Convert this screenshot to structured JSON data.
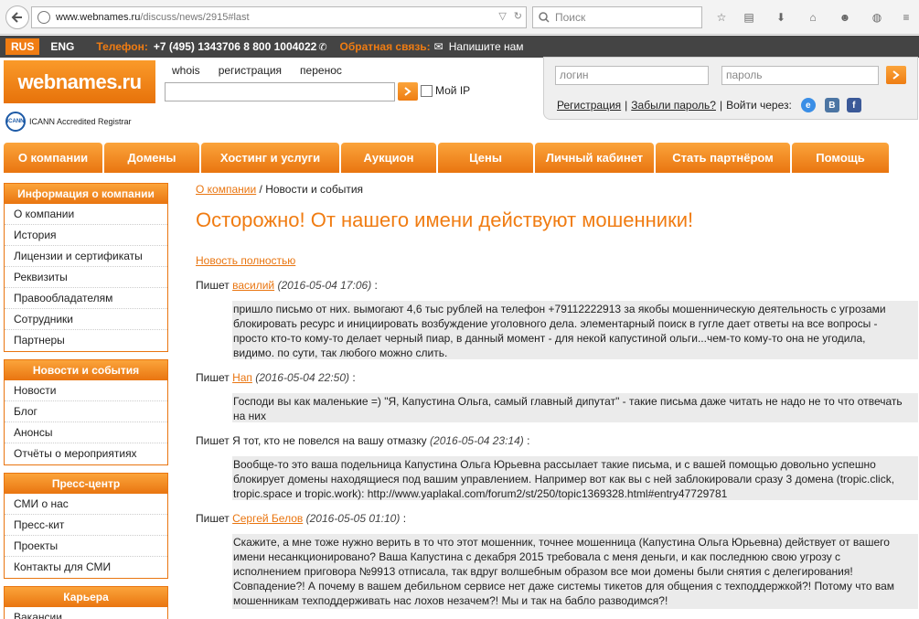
{
  "browser": {
    "url_host": "www.webnames.ru",
    "url_path": "/discuss/news/2915#last",
    "search_placeholder": "Поиск"
  },
  "topline": {
    "lang_ru": "RUS",
    "lang_en": "ENG",
    "phone_label": "Телефон:",
    "phone_numbers": "+7 (495) 1343706  8 800 1004022",
    "feedback_label": "Обратная связь:",
    "feedback_link": "Напишите нам"
  },
  "header": {
    "logo_text": "webnames.ru",
    "icann_text": "ICANN Accredited Registrar",
    "nav": [
      "whois",
      "регистрация",
      "перенос"
    ],
    "my_ip_label": "Мой IP"
  },
  "login": {
    "login_placeholder": "логин",
    "password_placeholder": "пароль",
    "register_link": "Регистрация",
    "forgot_link": "Забыли пароль?",
    "login_via": "Войти через:",
    "social": [
      "e",
      "В",
      "f"
    ]
  },
  "main_nav": [
    "О компании",
    "Домены",
    "Хостинг и услуги",
    "Аукцион",
    "Цены",
    "Личный кабинет",
    "Стать партнёром",
    "Помощь"
  ],
  "sidebar": [
    {
      "header": "Информация о компании",
      "items": [
        "О компании",
        "История",
        "Лицензии и сертификаты",
        "Реквизиты",
        "Правообладателям",
        "Сотрудники",
        "Партнеры"
      ]
    },
    {
      "header": "Новости и события",
      "items": [
        "Новости",
        "Блог",
        "Анонсы",
        "Отчёты о мероприятиях"
      ]
    },
    {
      "header": "Пресс-центр",
      "items": [
        "СМИ о нас",
        "Пресс-кит",
        "Проекты",
        "Контакты для СМИ"
      ]
    },
    {
      "header": "Карьера",
      "items": [
        "Вакансии"
      ]
    }
  ],
  "content": {
    "breadcrumb_link": "О компании",
    "breadcrumb_current": "Новости и события",
    "title": "Осторожно! От нашего имени действуют мошенники!",
    "full_news_link": "Новость полностью",
    "posts": [
      {
        "prefix": "Пишет",
        "author": "василий",
        "author_link": true,
        "date": "(2016-05-04 17:06)",
        "text": "пришло письмо от них. вымогают 4,6 тыс рублей на телефон +79112222913 за якобы мошенническую деятельность с угрозами блокировать ресурс и инициировать возбуждение уголовного дела. элементарный поиск в гугле дает ответы на все вопросы - просто кто-то кому-то делает черный пиар, в данный момент - для некой капустиной ольги...чем-то кому-то она не угодила, видимо. по сути, так любого можно слить."
      },
      {
        "prefix": "Пишет",
        "author": "Нап",
        "author_link": true,
        "date": "(2016-05-04 22:50)",
        "text": "Господи вы как маленькие =) \"Я, Капустина Ольга, самый главный дипутат\" - такие письма даже читать не надо не то что отвечать на них"
      },
      {
        "prefix": "Пишет",
        "author": "Я тот, кто не повелся на вашу отмазку",
        "author_link": false,
        "date": "(2016-05-04 23:14)",
        "text": "Вообще-то это ваша подельница Капустина Ольга Юрьевна рассылает такие письма, и с вашей помощью довольно успешно блокирует домены находящиеся под вашим управлением. Например вот как вы с ней заблокировали сразу 3 домена (tropic.click, tropic.space и tropic.work): http://www.yaplakal.com/forum2/st/250/topic1369328.html#entry47729781"
      },
      {
        "prefix": "Пишет",
        "author": "Сергей Белов",
        "author_link": true,
        "date": "(2016-05-05 01:10)",
        "text": "Скажите, а мне тоже нужно верить в то что этот мошенник, точнее мошенница (Капустина Ольга Юрьевна) действует от вашего имени несанкционировано? Ваша Капустина с декабря 2015 требовала с меня деньги, и как последнюю свою угрозу с исполнением приговора №9913 отписала, так вдруг волшебным образом все мои домены были снятия с делегирования! Совпадение?! А почему в вашем дебильном сервисе нет даже системы тикетов для общения с техподдержкой?! Потому что вам мошенникам техподдерживать нас лохов незачем?! Мы и так на бабло разводимся?!"
      }
    ]
  },
  "colors": {
    "accent": "#f07c12",
    "topline_bg": "#444444",
    "post_bg": "#ebebeb"
  }
}
